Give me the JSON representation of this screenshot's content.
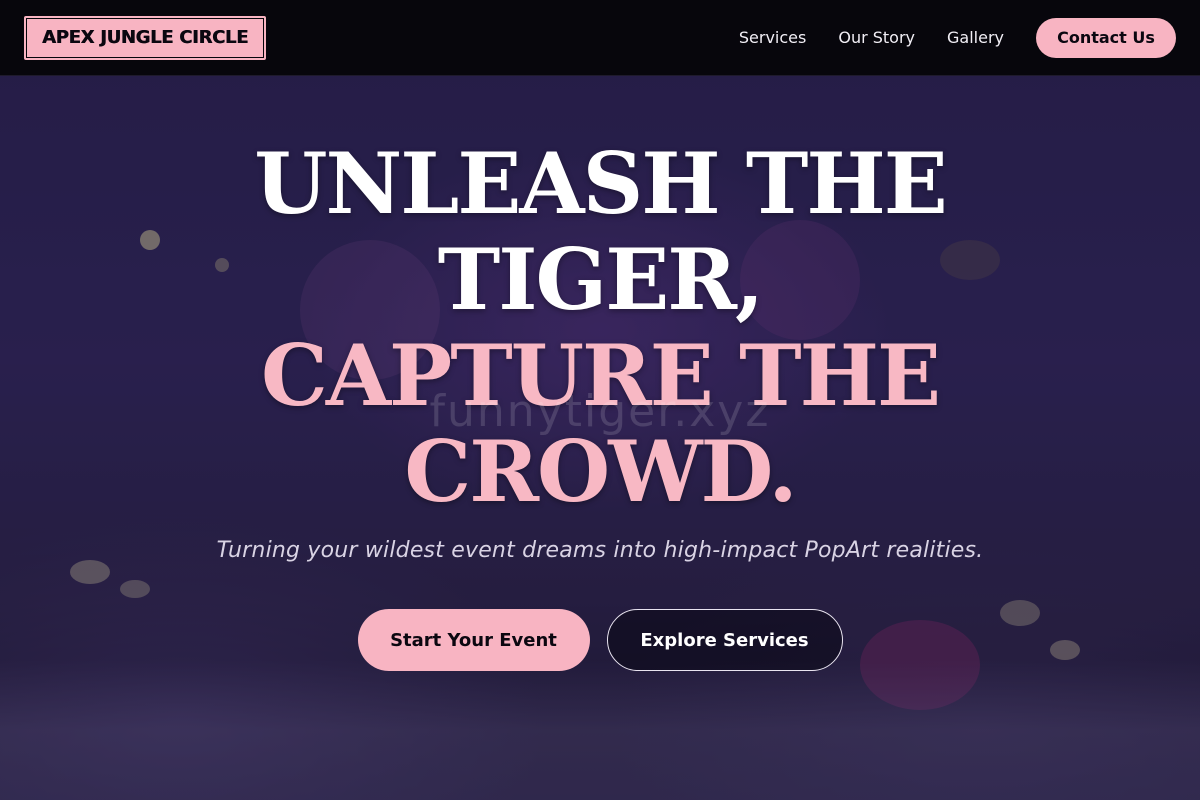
{
  "brand": {
    "logo_text": "APEX JUNGLE CIRCLE"
  },
  "nav": {
    "links": [
      "Services",
      "Our Story",
      "Gallery"
    ],
    "contact_label": "Contact Us"
  },
  "hero": {
    "headline_line1": "UNLEASH THE",
    "headline_line2": "TIGER,",
    "headline_line3": "CAPTURE THE",
    "headline_line4": "CROWD.",
    "watermark": "funnytiger.xyz",
    "tagline": "Turning your wildest event dreams into high-impact PopArt realities.",
    "primary_cta": "Start Your Event",
    "secondary_cta": "Explore Services"
  },
  "colors": {
    "accent_pink": "#f8b4c2",
    "nav_background": "#07060c",
    "hero_purple": "#2a2150"
  }
}
